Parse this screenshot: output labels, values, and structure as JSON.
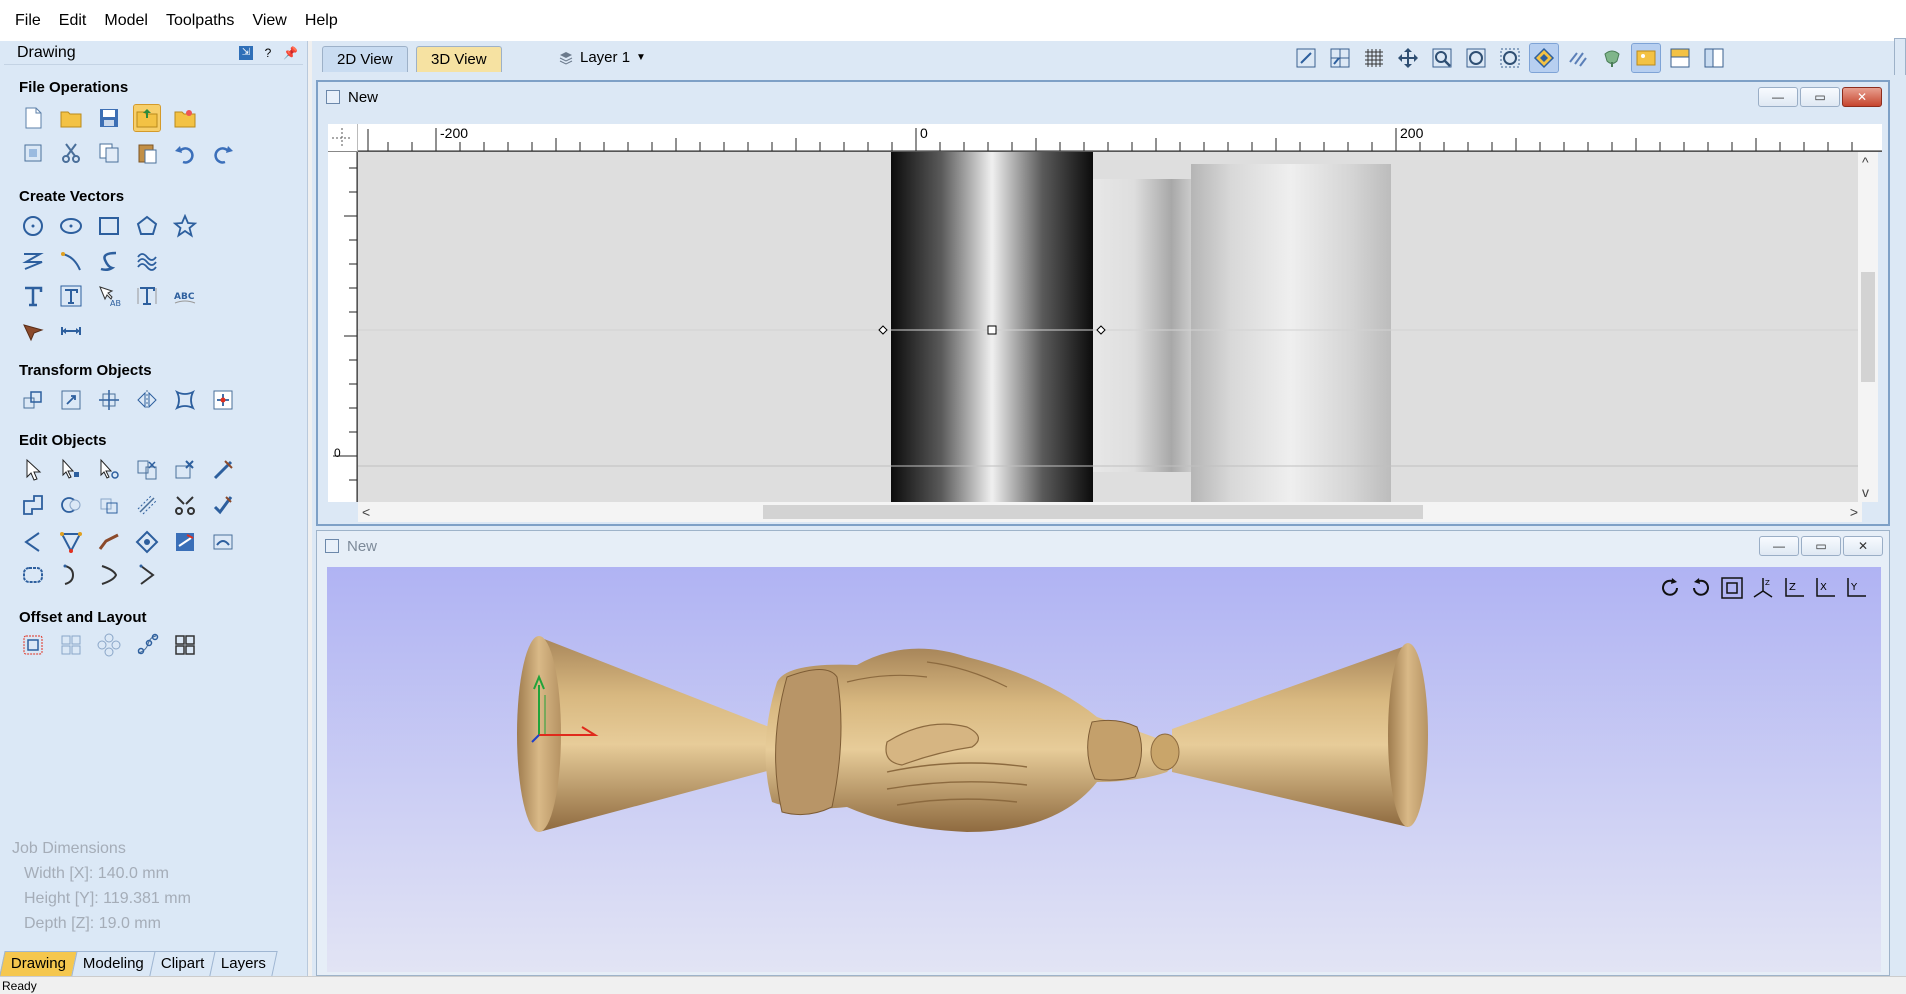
{
  "menu": [
    "File",
    "Edit",
    "Model",
    "Toolpaths",
    "View",
    "Help"
  ],
  "panel": {
    "title": "Drawing",
    "help_label": "?",
    "sections": {
      "file_operations": "File Operations",
      "create_vectors": "Create Vectors",
      "transform_objects": "Transform Objects",
      "edit_objects": "Edit Objects",
      "offset_layout": "Offset and Layout"
    },
    "tabs": [
      "Drawing",
      "Modeling",
      "Clipart",
      "Layers"
    ],
    "active_tab": "Drawing"
  },
  "job": {
    "title": "Job Dimensions",
    "width": "Width  [X]: 140.0 mm",
    "height": "Height [Y]: 119.381 mm",
    "depth": "Depth  [Z]: 19.0 mm"
  },
  "views": {
    "tab_2d": "2D View",
    "tab_3d": "3D View",
    "layer": "Layer 1"
  },
  "window_2d": {
    "title": "New",
    "ruler_labels": [
      "-200",
      "0",
      "200"
    ],
    "vruler_label": "0"
  },
  "window_3d": {
    "title": "New"
  },
  "status": "Ready",
  "colors": {
    "panel_bg": "#dbe8f6",
    "active_tab": "#f5c74e",
    "viewport_top": "#b0b3f3",
    "wood": "#c9a56a"
  }
}
